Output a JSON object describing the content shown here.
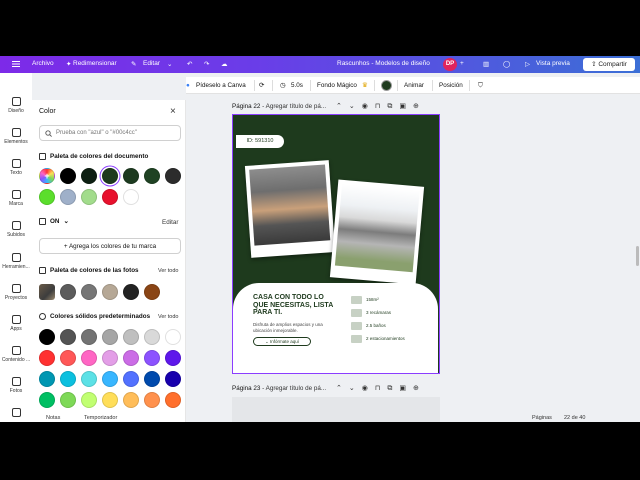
{
  "topbar": {
    "archivo": "Archivo",
    "redimensionar": "Redimensionar",
    "editar": "Editar",
    "doc_title": "Rascunhos - Modelos de diseño",
    "avatar": "DP",
    "vista_previa": "Vista previa",
    "compartir": "Compartir"
  },
  "toolbar": {
    "pidesolo": "Pídeselo a Canva",
    "duration": "5.0s",
    "fondo_magico": "Fondo Mágico",
    "animar": "Animar",
    "posicion": "Posición"
  },
  "rail": [
    {
      "label": "Diseño",
      "icon": "layout-icon"
    },
    {
      "label": "Elementos",
      "icon": "shapes-icon"
    },
    {
      "label": "Texto",
      "icon": "text-icon"
    },
    {
      "label": "Marca",
      "icon": "brand-icon"
    },
    {
      "label": "Subidos",
      "icon": "upload-icon"
    },
    {
      "label": "Herramien...",
      "icon": "tools-icon"
    },
    {
      "label": "Proyectos",
      "icon": "folder-icon"
    },
    {
      "label": "Apps",
      "icon": "apps-icon"
    },
    {
      "label": "Contenido ...",
      "icon": "content-icon"
    },
    {
      "label": "Fotos",
      "icon": "photo-icon"
    },
    {
      "label": "",
      "icon": "more-icon"
    }
  ],
  "panel": {
    "title": "Color",
    "search_placeholder": "Prueba con \"azul\" o \"#00c4cc\"",
    "doc_palette": "Paleta de colores del documento",
    "doc_colors": [
      "#000000",
      "#0d1f12",
      "#1e3a1d",
      "#1d3b20",
      "#1f4223",
      "#2c2c2c",
      "#5bde2c",
      "#9fb0c9",
      "#a2dc8c",
      "#e8112d",
      "#ffffff"
    ],
    "on_label": "ON",
    "editar_label": "Editar",
    "brand_button": "Agrega los colores de tu marca",
    "photo_palette": "Paleta de colores de las fotos",
    "ver_todo_1": "Ver todo",
    "photo_colors": [
      "#5c5c5c",
      "#767676",
      "#b6a896",
      "#232323",
      "#8a4515"
    ],
    "solid_title": "Colores sólidos predeterminados",
    "ver_todo_2": "Ver todo",
    "solid_colors": [
      [
        "#000000",
        "#545454",
        "#737373",
        "#a6a6a6",
        "#bfbfbf",
        "#d9d9d9",
        "#ffffff"
      ],
      [
        "#ff3131",
        "#ff5757",
        "#ff66c4",
        "#e39ee7",
        "#cb6ce6",
        "#8c52ff",
        "#5e17eb"
      ],
      [
        "#0097b2",
        "#0cc0df",
        "#5ce1e6",
        "#38b6ff",
        "#5271ff",
        "#004aad",
        "#1800ad"
      ],
      [
        "#00bf63",
        "#7ed957",
        "#c1ff72",
        "#ffde59",
        "#ffbd59",
        "#ff914d",
        "#ff6f2c"
      ]
    ]
  },
  "pages": {
    "p22_label": "Página 22",
    "p22_title": "Agregar título de pá...",
    "p23_label": "Página 23",
    "p23_title": "Agregar título de pá..."
  },
  "design": {
    "id_tag": "ID: 591310",
    "headline": "CASA CON TODO LO QUE NECESITAS, LISTA PARA TI.",
    "description": "Disfruta de amplios espacios y una ubicación inmejorable.",
    "info_button": "Infórmate aquí",
    "features": [
      "158m²",
      "3 recámaras",
      "2.5 baños",
      "2 estacionamientos"
    ]
  },
  "bottombar": {
    "notas": "Notas",
    "temporizador": "Temporizador",
    "paginas": "Páginas",
    "page_count": "22 de 40"
  }
}
